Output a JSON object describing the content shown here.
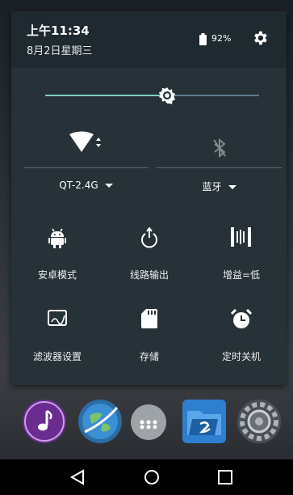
{
  "status": {
    "time": "上午11:34",
    "date": "8月2日星期三",
    "battery_percent": "92%",
    "battery_icon": "battery-icon",
    "settings_icon": "gear-icon"
  },
  "brightness": {
    "level": 0.57,
    "icon": "brightness-icon"
  },
  "toggles": [
    {
      "label": "QT-2.4G",
      "icon": "wifi-icon",
      "state": "on"
    },
    {
      "label": "蓝牙",
      "icon": "bluetooth-icon",
      "state": "off"
    }
  ],
  "tiles": [
    {
      "label": "安卓模式",
      "icon": "android-icon"
    },
    {
      "label": "线路输出",
      "icon": "power-icon"
    },
    {
      "label": "增益=低",
      "icon": "gain-icon"
    },
    {
      "label": "滤波器设置",
      "icon": "filter-icon"
    },
    {
      "label": "存储",
      "icon": "sdcard-icon"
    },
    {
      "label": "定时关机",
      "icon": "alarm-icon"
    }
  ],
  "dock": [
    {
      "icon": "music-app-icon",
      "color": "#6a2c91"
    },
    {
      "icon": "browser-app-icon",
      "color": "#2b6ca3"
    },
    {
      "icon": "app-drawer-icon",
      "color": "#9ea3a8"
    },
    {
      "icon": "file-explorer-app-icon",
      "color": "#2f7fd0"
    },
    {
      "icon": "settings-app-icon",
      "color": "#4a4f55"
    }
  ],
  "navigation": {
    "back": "back-icon",
    "home": "home-icon",
    "recents": "recents-icon"
  },
  "colors": {
    "accent": "#80cbc4",
    "panel": "#263238",
    "header": "#1f2a30"
  }
}
